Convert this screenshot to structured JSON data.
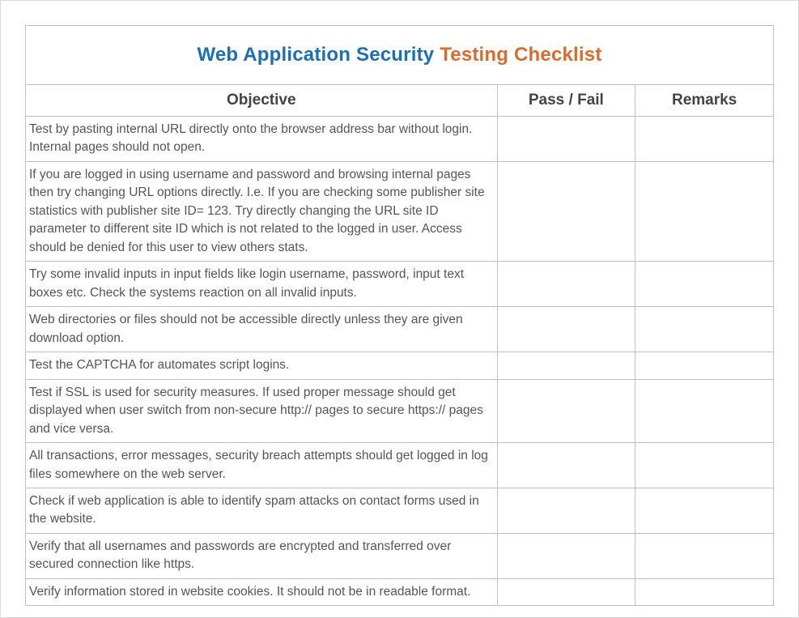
{
  "title": {
    "part1": "Web Application Security ",
    "part2": "Testing Checklist"
  },
  "headers": {
    "objective": "Objective",
    "passfail": "Pass / Fail",
    "remarks": "Remarks"
  },
  "rows": [
    {
      "objective": "Test by pasting internal URL directly onto the browser address bar without login. Internal pages should not open.",
      "passfail": "",
      "remarks": ""
    },
    {
      "objective": "If you are logged in using username and password and browsing internal pages then try changing URL options directly. I.e. If you are checking some publisher site statistics with publisher site ID= 123. Try directly changing the URL site ID parameter to different site ID which is not related to the logged in user. Access should be denied for this user to view others stats.",
      "passfail": "",
      "remarks": ""
    },
    {
      "objective": "Try some invalid inputs in input fields like login username, password, input text boxes etc. Check the systems reaction on all invalid inputs.",
      "passfail": "",
      "remarks": ""
    },
    {
      "objective": "Web directories or files should not be accessible directly unless they are given download option.",
      "passfail": "",
      "remarks": ""
    },
    {
      "objective": "Test the CAPTCHA for automates script logins.",
      "passfail": "",
      "remarks": ""
    },
    {
      "objective": "Test if SSL is used for security measures. If used proper message should get displayed when user switch from non-secure http:// pages to secure https:// pages and vice versa.",
      "passfail": "",
      "remarks": ""
    },
    {
      "objective": "All transactions, error messages, security breach attempts should get logged in log files somewhere on the web server.",
      "passfail": "",
      "remarks": ""
    },
    {
      "objective": "Check if web application is able to identify spam attacks on contact forms used in the website.",
      "passfail": "",
      "remarks": ""
    },
    {
      "objective": "Verify that all usernames and passwords are encrypted and transferred over secured connection like https.",
      "passfail": "",
      "remarks": ""
    },
    {
      "objective": "Verify information stored in website cookies. It should not be in readable format.",
      "passfail": "",
      "remarks": ""
    }
  ]
}
